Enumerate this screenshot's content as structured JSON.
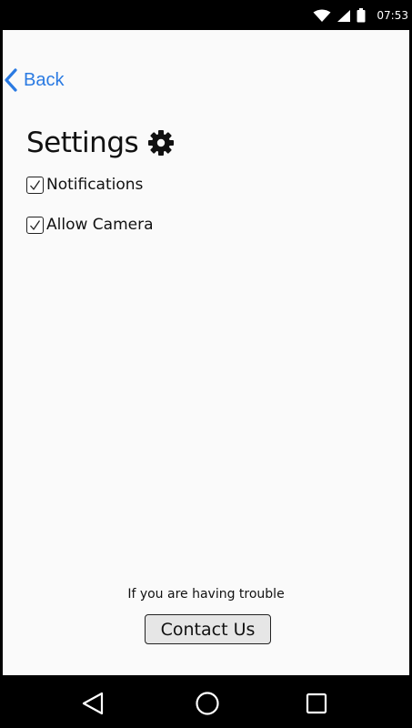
{
  "status_bar": {
    "time": "07:53",
    "icons": [
      "wifi-icon",
      "cell-signal-icon",
      "battery-icon"
    ]
  },
  "navigation": {
    "back_label": "Back"
  },
  "settings": {
    "title": "Settings",
    "title_icon": "gear-icon",
    "options": [
      {
        "label": "Notifications",
        "checked": true
      },
      {
        "label": "Allow Camera",
        "checked": true
      }
    ]
  },
  "help": {
    "text": "If you are having trouble",
    "contact_label": "Contact Us"
  },
  "nav_bar": {
    "buttons": [
      "back-triangle-icon",
      "home-circle-icon",
      "recents-square-icon"
    ]
  },
  "colors": {
    "accent": "#2a7ae2",
    "background": "#fafafa",
    "bars": "#000000",
    "button_fill": "#e6e6e6"
  }
}
